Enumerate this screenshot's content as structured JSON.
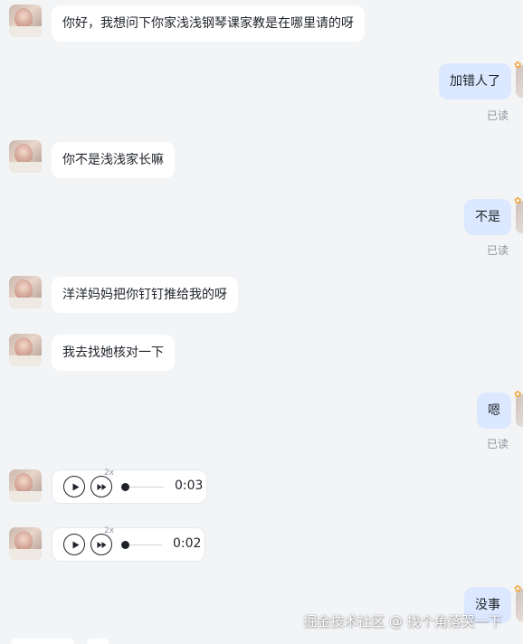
{
  "messages": [
    {
      "side": "in",
      "text": "你好，我想问下你家浅浅钢琴课家教是在哪里请的呀"
    },
    {
      "side": "out",
      "text": "加错人了",
      "status": "已读"
    },
    {
      "side": "in",
      "text": "你不是浅浅家长嘛"
    },
    {
      "side": "out",
      "text": "不是",
      "status": "已读"
    },
    {
      "side": "in",
      "text": "洋洋妈妈把你钉钉推给我的呀"
    },
    {
      "side": "in",
      "text": "我去找她核对一下"
    },
    {
      "side": "out",
      "text": "嗯",
      "status": "已读"
    },
    {
      "side": "in",
      "type": "voice",
      "speed": "2x",
      "duration": "0:03"
    },
    {
      "side": "in",
      "type": "voice",
      "speed": "2x",
      "duration": "0:02"
    },
    {
      "side": "out",
      "text": "没事"
    }
  ],
  "watermark": "掘金技术社区 @ 找个角落哭一下",
  "colors": {
    "background": "#f3f4f6",
    "incoming_bubble": "#ffffff",
    "outgoing_bubble": "#dbe8ff",
    "read_status": "#8f959e"
  },
  "icons": {
    "play": "play-icon",
    "speed": "fast-forward-icon",
    "avatar": "avatar"
  }
}
